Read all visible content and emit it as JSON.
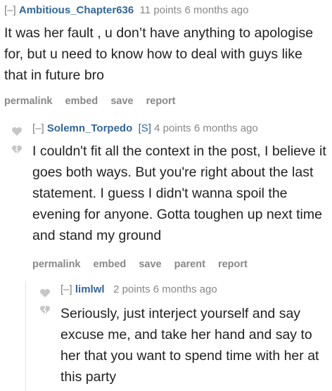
{
  "comments": [
    {
      "toggle": "[–]",
      "author": "Ambitious_Chapter636",
      "submitter": "",
      "score": "11 points",
      "time": "6 months ago",
      "text": "It was her fault , u don’t have anything to apologise for, but u need to know how to deal with guys like that in future bro",
      "actions": [
        "permalink",
        "embed",
        "save",
        "report"
      ]
    },
    {
      "toggle": "[–]",
      "author": "Solemn_Torpedo",
      "submitter": "[S]",
      "score": "4 points",
      "time": "6 months ago",
      "text": "I couldn't fit all the context in the post, I believe it goes both ways. But you're right about the last statement. I guess I didn't wanna spoil the evening for anyone. Gotta toughen up next time and stand my ground",
      "actions": [
        "permalink",
        "embed",
        "save",
        "parent",
        "report"
      ]
    },
    {
      "toggle": "[–]",
      "author": "limlwl",
      "submitter": "",
      "score": "2 points",
      "time": "6 months ago",
      "text": "Seriously, just interject yourself and say excuse me, and take her hand and say to her that you want to spend time with her at this party"
    }
  ],
  "icons": {
    "upvote": "heart-up-icon",
    "downvote": "heart-down-icon"
  },
  "colors": {
    "author": "#336699",
    "meta": "#888888",
    "text": "#222222",
    "vote": "#c6c6c6"
  }
}
